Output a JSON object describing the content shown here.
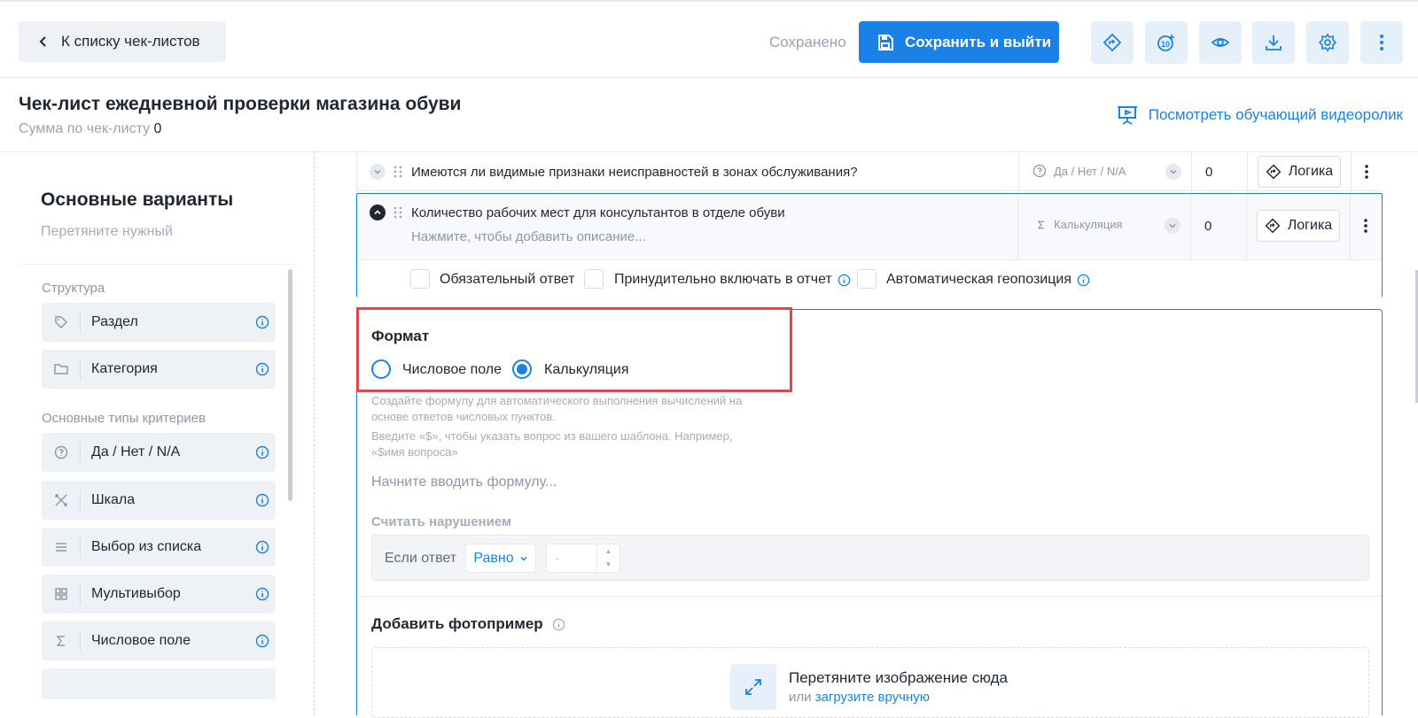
{
  "header": {
    "back_label": "К списку чек-листов",
    "saved_status": "Сохранено",
    "save_label": "Сохранить и выйти"
  },
  "titlebar": {
    "title": "Чек-лист ежедневной проверки магазина обуви",
    "sum_label": "Сумма по чек-листу",
    "sum_value": "0",
    "video_link": "Посмотреть обучающий видеоролик"
  },
  "left_panel": {
    "title": "Основные варианты",
    "subtitle": "Перетяните нужный",
    "group_structure": "Структура",
    "group_types": "Основные типы критериев",
    "items": [
      {
        "label": "Раздел",
        "icon": "tag-icon"
      },
      {
        "label": "Категория",
        "icon": "folder-icon"
      },
      {
        "label": "Да / Нет / N/A",
        "icon": "question-icon"
      },
      {
        "label": "Шкала",
        "icon": "scale-icon"
      },
      {
        "label": "Выбор из списка",
        "icon": "list-icon"
      },
      {
        "label": "Мультивыбор",
        "icon": "grid-icon"
      },
      {
        "label": "Числовое поле",
        "icon": "sigma-icon"
      }
    ]
  },
  "questions": [
    {
      "text": "Имеются ли видимые признаки неисправностей в зонах обслуживания?",
      "type": "Да / Нет / N/A",
      "score": "0",
      "logic": "Логика"
    },
    {
      "text": "Количество рабочих мест для консультантов в отделе обуви",
      "description": "Нажмите, чтобы добавить описание...",
      "type": "Калькуляция",
      "score": "0",
      "logic": "Логика"
    }
  ],
  "options": {
    "required": "Обязательный ответ",
    "force_report": "Принудительно включать в отчет",
    "geo": "Автоматическая геопозиция"
  },
  "format": {
    "title": "Формат",
    "option_number": "Числовое поле",
    "option_calc": "Калькуляция",
    "selected": "Калькуляция",
    "hint1": "Создайте формулу для автоматического выполнения вычислений на основе ответов числовых пунктов.",
    "hint2": "Введите «$», чтобы указать вопрос из вашего шаблона. Например, «$имя вопроса»",
    "formula_placeholder": "Начните вводить формулу...",
    "violation_title": "Считать нарушением",
    "if_answer": "Если ответ",
    "operator": "Равно",
    "value_placeholder": "-"
  },
  "photo": {
    "title": "Добавить фотопример",
    "drop_text": "Перетяните изображение сюда",
    "or": "или",
    "upload_link": "загрузите вручную"
  },
  "colors": {
    "accent": "#1a82e6",
    "highlight": "#e0474c"
  }
}
